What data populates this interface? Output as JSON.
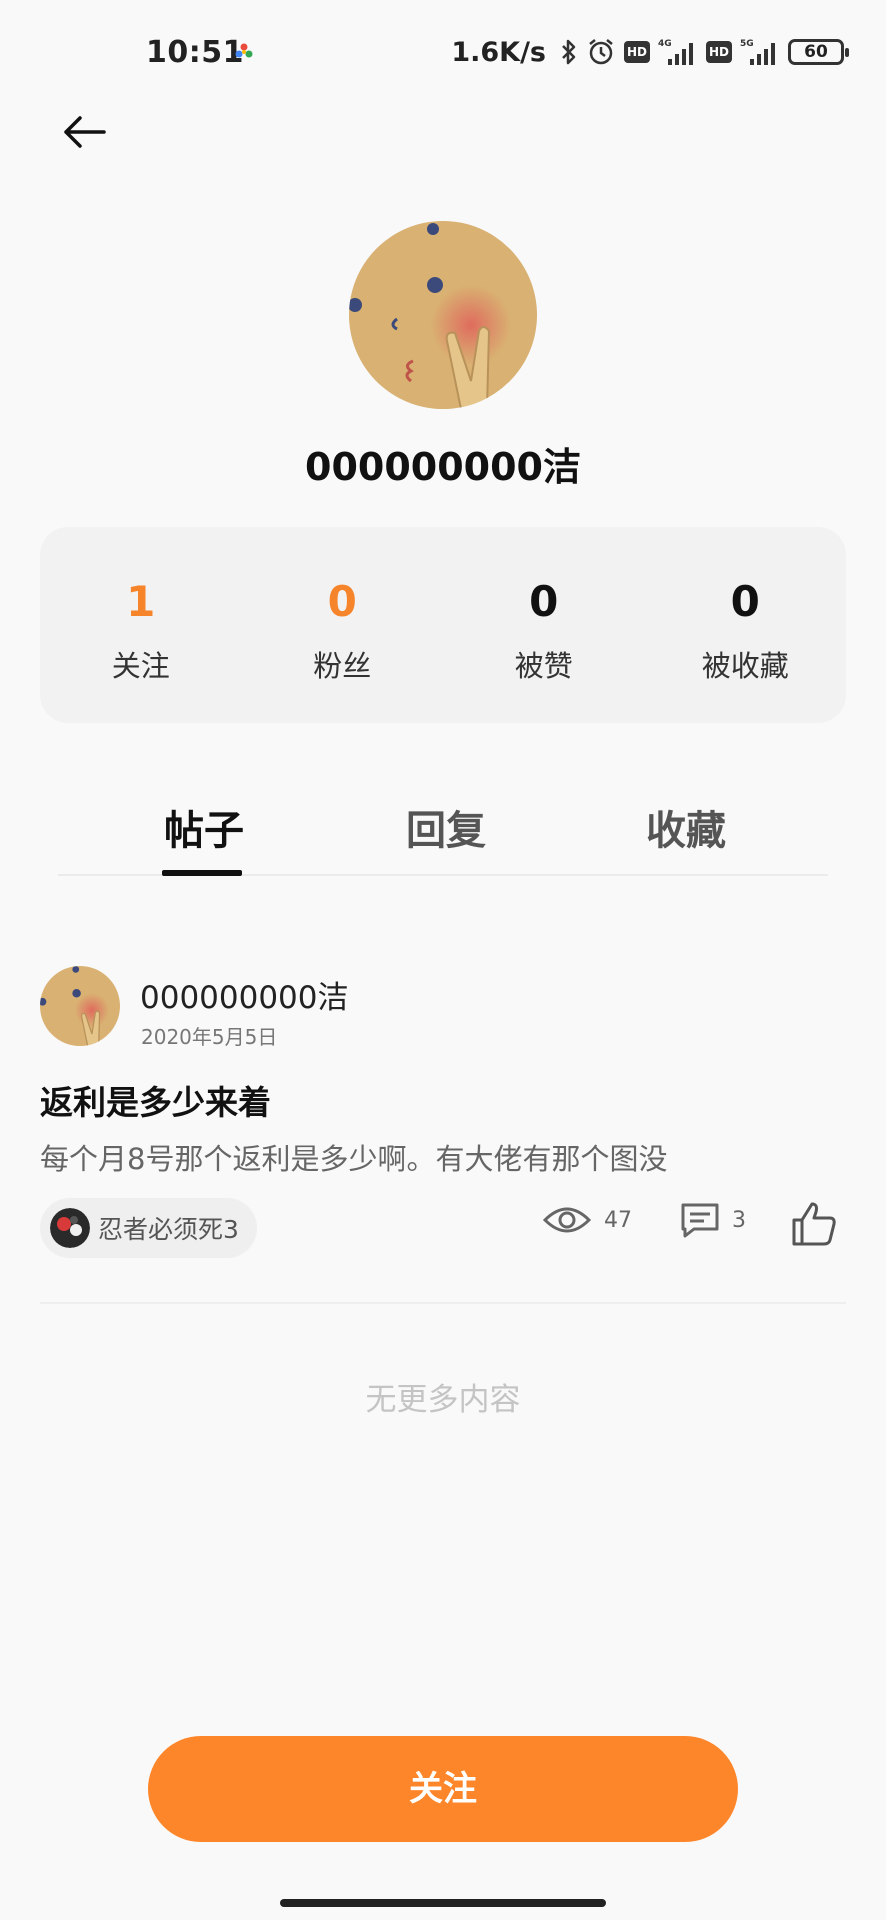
{
  "status_bar": {
    "time": "10:51",
    "net_speed": "1.6K/s",
    "hd_badge": "HD",
    "net_4g": "4G",
    "net_5g": "5G",
    "battery": "60"
  },
  "profile": {
    "name": "000000000洁",
    "avatar_icon": "avatar-image"
  },
  "stats": [
    {
      "value": "1",
      "label": "关注",
      "highlight": true
    },
    {
      "value": "0",
      "label": "粉丝",
      "highlight": true
    },
    {
      "value": "0",
      "label": "被赞",
      "highlight": false
    },
    {
      "value": "0",
      "label": "被收藏",
      "highlight": false
    }
  ],
  "tabs": [
    {
      "label": "帖子",
      "active": true
    },
    {
      "label": "回复",
      "active": false
    },
    {
      "label": "收藏",
      "active": false
    }
  ],
  "post": {
    "author": "000000000洁",
    "date": "2020年5月5日",
    "title": "返利是多少来着",
    "excerpt": "每个月8号那个返利是多少啊。有大佬有那个图没",
    "tag": "忍者必须死3",
    "views": "47",
    "comments": "3"
  },
  "footer": {
    "no_more": "无更多内容",
    "follow_button": "关注"
  },
  "colors": {
    "accent": "#fe862a",
    "stat_highlight": "#f5842a",
    "background": "#f9f9f9",
    "card": "#f2f2f2"
  }
}
